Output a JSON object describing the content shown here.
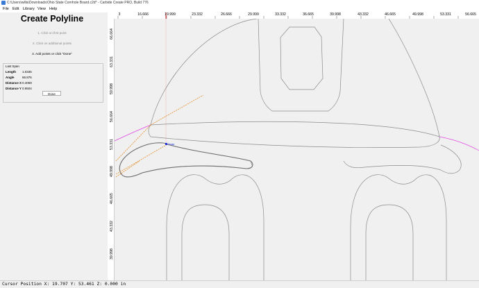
{
  "window": {
    "title": "C:\\Users\\willa\\Downloads\\Ohio State Cornhole Board.c2d* - Carbide Create PRO, Build 776"
  },
  "menu": [
    "File",
    "Edit",
    "Library",
    "View",
    "Help"
  ],
  "panel": {
    "heading": "Create Polyline",
    "steps": [
      "1. Click on first point",
      "2. Click on additional points",
      "3. Add points or click \"Done\""
    ],
    "last_span_label": "Last Span",
    "rows": [
      {
        "key": "Length",
        "value": "1.0335"
      },
      {
        "key": "Angle",
        "value": "66.876"
      },
      {
        "key": "Distance X",
        "value": "0.4059"
      },
      {
        "key": "Distance Y",
        "value": "0.9504"
      }
    ],
    "done_label": "Done"
  },
  "rulers": {
    "x_labels": [
      "3",
      "16.666",
      "19.999",
      "23.332",
      "26.666",
      "29.999",
      "33.332",
      "36.665",
      "39.998",
      "43.332",
      "46.665",
      "49.998",
      "53.331",
      "56.665"
    ],
    "y_labels": [
      "66.664",
      "63.331",
      "59.998",
      "56.664",
      "53.331",
      "49.998",
      "46.665",
      "43.332",
      "39.998"
    ]
  },
  "canvas": {
    "snap_label": "Snap"
  },
  "status": {
    "text": "Cursor Position X: 19.707 Y: 53.461 Z: 0.000 in"
  },
  "colors": {
    "accent_path": "#e08010",
    "guide": "#e040e0",
    "cursor_line": "#e02020",
    "snap": "#2030e0"
  }
}
